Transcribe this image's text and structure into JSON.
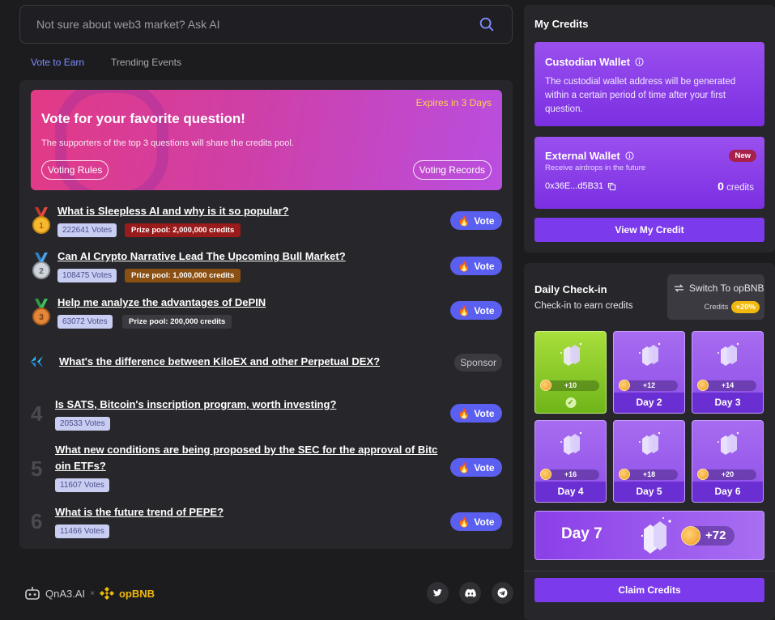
{
  "search": {
    "placeholder": "Not sure about web3 market? Ask AI"
  },
  "tabs": [
    {
      "label": "Vote to Earn",
      "active": true
    },
    {
      "label": "Trending Events",
      "active": false
    }
  ],
  "banner": {
    "title": "Vote for your favorite question!",
    "description": "The supporters of the top 3 questions will share the credits pool.",
    "expires": "Expires in 3 Days",
    "rules_label": "Voting Rules",
    "records_label": "Voting Records"
  },
  "vote_label": "Vote",
  "questions": [
    {
      "rank": "1",
      "medal": "gold",
      "title": "What is Sleepless AI and why is it so popular?",
      "votes": "222641 Votes",
      "prize": "Prize pool:  2,000,000 credits",
      "prize_color": "#991b1b"
    },
    {
      "rank": "2",
      "medal": "silver",
      "title": "Can AI Crypto Narrative Lead The Upcoming Bull Market?",
      "votes": "108475 Votes",
      "prize": "Prize pool:  1,000,000 credits",
      "prize_color": "#8a4f12"
    },
    {
      "rank": "3",
      "medal": "bronze",
      "title": "Help me analyze the advantages of DePIN",
      "votes": "63072 Votes",
      "prize": "Prize pool:  200,000 credits",
      "prize_color": "#3a3a40"
    }
  ],
  "sponsor": {
    "title": "What's the difference between KiloEX and other Perpetual DEX?",
    "badge": "Sponsor"
  },
  "other_questions": [
    {
      "rank": "4",
      "title_line1": "Is SATS, Bitcoin's inscription program, worth investing?",
      "title_line2": "",
      "votes": "20533 Votes"
    },
    {
      "rank": "5",
      "title_line1": "What new conditions are being proposed by the SEC for the approval of Bitc",
      "title_line2": "oin ETFs?",
      "votes": "11607 Votes"
    },
    {
      "rank": "6",
      "title_line1": "What is the future trend of PEPE?",
      "title_line2": "",
      "votes": "11466 Votes"
    }
  ],
  "footer": {
    "brand": "QnA3.AI",
    "separator": "×",
    "partner": "opBNB",
    "social": [
      "twitter-icon",
      "discord-icon",
      "telegram-icon"
    ]
  },
  "credits": {
    "title": "My Credits",
    "custodian": {
      "title": "Custodian Wallet",
      "text": "The custodial wallet address will be generated within a certain period of time after your first question."
    },
    "external": {
      "title": "External Wallet",
      "badge": "New",
      "subtitle": "Receive airdrops in the future",
      "address": "0x36E...d5B31",
      "credit_value": "0",
      "credit_unit": "credits"
    },
    "view_button": "View My Credit"
  },
  "checkin": {
    "title": "Daily Check-in",
    "subtitle": "Check-in to earn credits",
    "switch_label": "Switch To opBNB",
    "switch_credits_label": "Credits",
    "switch_bonus": "+20%",
    "days": [
      {
        "reward": "+10",
        "label": "",
        "done": true
      },
      {
        "reward": "+12",
        "label": "Day 2",
        "done": false
      },
      {
        "reward": "+14",
        "label": "Day 3",
        "done": false
      },
      {
        "reward": "+16",
        "label": "Day 4",
        "done": false
      },
      {
        "reward": "+18",
        "label": "Day 5",
        "done": false
      },
      {
        "reward": "+20",
        "label": "Day 6",
        "done": false
      }
    ],
    "day7": {
      "label": "Day 7",
      "reward": "+72"
    },
    "claim_button": "Claim Credits"
  },
  "colors": {
    "accent": "#7c3aed",
    "vote": "#5b5ff0",
    "link_tab": "#7f8cff",
    "expires": "#ffd24a"
  }
}
